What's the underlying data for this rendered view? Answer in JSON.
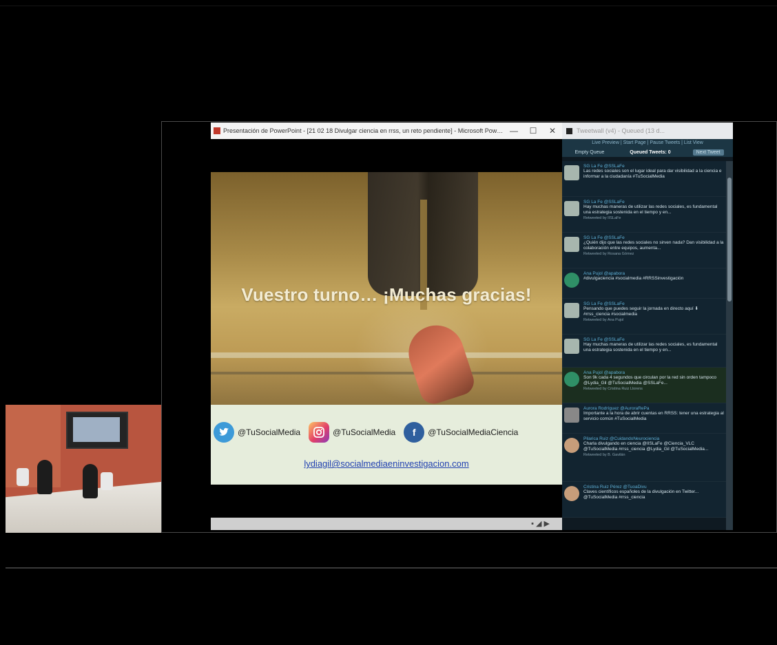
{
  "powerpoint": {
    "window_title": "Presentación de PowerPoint - [21 02 18 Divulgar ciencia en rrss, un reto pendiente] - Microsoft PowerP...",
    "btn_minimize": "—",
    "btn_maximize": "☐",
    "btn_close": "✕",
    "slide": {
      "heading": "Vuestro turno… ¡Muchas gracias!",
      "twitter_handle": "@TuSocialMedia",
      "instagram_handle": "@TuSocialMedia",
      "facebook_handle": "@TuSocialMediaCiencia",
      "email": "lydiagil@socialmediaeninvestigacion.com"
    },
    "status_icons": "▪ ◢ ▶"
  },
  "tweetwall": {
    "window_title": "Tweetwall (v4) - Queued (13 d...",
    "toolbar": "Live Preview | Start Page | Pause Tweets | List View",
    "tabs": {
      "empty_queue": "Empty Queue",
      "queued_tweets": "Queued Tweets: 0",
      "next_tweet": "Next Tweet"
    },
    "tweets": [
      {
        "user": "SG La Fe @SSLaFe",
        "text": "Las redes sociales son el lugar ideal para dar visibilidad a la ciencia e informar a la ciudadanía #TuSocialMedia",
        "meta": ""
      },
      {
        "user": "SG La Fe @SSLaFe",
        "text": "Hay muchas maneras de utilizar las redes sociales, es fundamental una estrategia sostenida en el tiempo y en...",
        "meta": "Retweeted by IISLaFe"
      },
      {
        "user": "SG La Fe @SSLaFe",
        "text": "¿Quién dijo que las redes sociales no sirven nada? Dan visibilidad a la colaboración entre equipos, aumenta...",
        "meta": "Retweeted by Rosana Gómez"
      },
      {
        "user": "Ana Pujol @apabora",
        "text": "#divulgaciencia #socialmedia #RRSSinvestigación",
        "meta": ""
      },
      {
        "user": "SG La Fe @SSLaFe",
        "text": "Pensando que puedes seguir la jornada en directo aquí ⬇ #rrss_ciencia #socialmedia",
        "meta": "Retweeted by Ana Pujol"
      },
      {
        "user": "SG La Fe @SSLaFe",
        "text": "Hay muchas maneras de utilizar las redes sociales, es fundamental una estrategia sostenida en el tiempo y en...",
        "meta": ""
      },
      {
        "user": "Ana Pujol @apabora",
        "text": "Son 9k cada 4 segundos que circulan por la red sin orden tampoco @Lydia_Gil @TuSocialMedia @SSLaFe...",
        "meta": "Retweeted by Cristina Ruiz Llorens"
      },
      {
        "user": "Aurora Rodríguez @AuroraRePa",
        "text": "Importante a la hora de abrir cuentas en RRSS: tener una estrategia al servicio común #TuSocialMedia",
        "meta": ""
      },
      {
        "user": "Pilarica Ruiz @CuidandoNeurociencia",
        "text": "Charla divulgando en ciencia @IISLaFe @Ciencia_VLC @TuSocialMedia #rrss_ciencia @Lydia_Gil @TuSocialMedia...",
        "meta": "Retweeted by B. Gavilán"
      },
      {
        "user": "Cristina Ruiz Pérez @TuoaDivu",
        "text": "Claves científicos españoles de la divulgación en Twitter... @TuSocialMedia #rrss_ciencia",
        "meta": ""
      }
    ]
  },
  "colors": {
    "background": "#000000",
    "tweet_user": "#5fb0d6",
    "email_link": "#1f3fb0"
  }
}
